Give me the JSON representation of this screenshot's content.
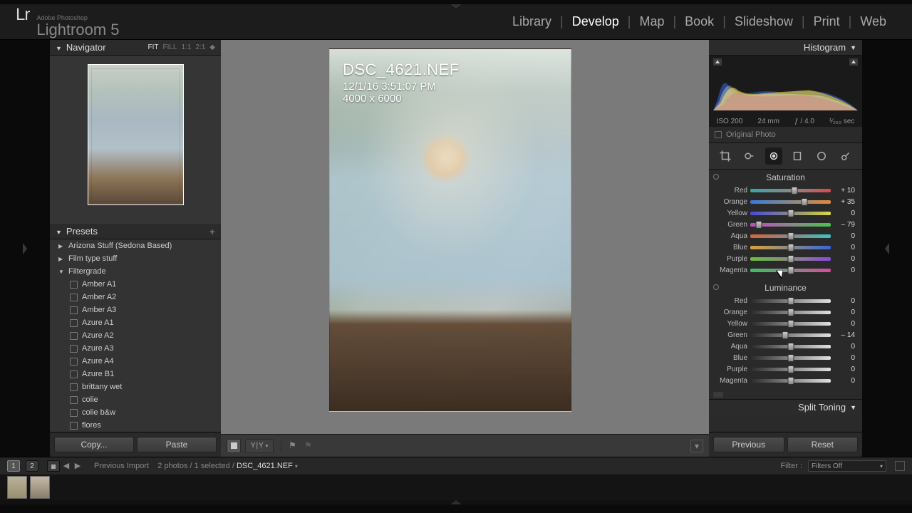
{
  "brand": {
    "lr": "Lr",
    "sub": "Adobe Photoshop",
    "name": "Lightroom 5"
  },
  "modules": [
    "Library",
    "Develop",
    "Map",
    "Book",
    "Slideshow",
    "Print",
    "Web"
  ],
  "active_module": "Develop",
  "navigator": {
    "title": "Navigator",
    "zoom": [
      "FIT",
      "FILL",
      "1:1",
      "2:1"
    ],
    "zoom_sel": "FIT"
  },
  "presets": {
    "title": "Presets",
    "folders": [
      {
        "name": "Arizona Stuff (Sedona Based)",
        "open": false
      },
      {
        "name": "Film type stuff",
        "open": false
      },
      {
        "name": "Filtergrade",
        "open": true,
        "items": [
          "Amber A1",
          "Amber A2",
          "Amber A3",
          "Azure A1",
          "Azure A2",
          "Azure A3",
          "Azure A4",
          "Azure B1",
          "brittany wet",
          "colie",
          "colie b&w",
          "flores"
        ]
      }
    ]
  },
  "left_buttons": {
    "copy": "Copy...",
    "paste": "Paste"
  },
  "photo_meta": {
    "filename": "DSC_4621.NEF",
    "datetime": "12/1/16 3:51:07 PM",
    "dimensions": "4000 x 6000"
  },
  "histogram": {
    "title": "Histogram",
    "meta": {
      "iso": "ISO 200",
      "focal": "24 mm",
      "aperture": "ƒ / 4.0",
      "shutter": "¹⁄₂₅₀ sec"
    },
    "original_label": "Original Photo"
  },
  "saturation": {
    "title": "Saturation",
    "rows": [
      {
        "label": "Red",
        "value": "+ 10",
        "pos": 55,
        "grad": "grad-sat-red"
      },
      {
        "label": "Orange",
        "value": "+ 35",
        "pos": 67,
        "grad": "grad-sat-orange"
      },
      {
        "label": "Yellow",
        "value": "0",
        "pos": 50,
        "grad": "grad-sat-yellow"
      },
      {
        "label": "Green",
        "value": "– 79",
        "pos": 11,
        "grad": "grad-sat-green"
      },
      {
        "label": "Aqua",
        "value": "0",
        "pos": 50,
        "grad": "grad-sat-aqua"
      },
      {
        "label": "Blue",
        "value": "0",
        "pos": 50,
        "grad": "grad-sat-blue"
      },
      {
        "label": "Purple",
        "value": "0",
        "pos": 50,
        "grad": "grad-sat-purple"
      },
      {
        "label": "Magenta",
        "value": "0",
        "pos": 50,
        "grad": "grad-sat-magenta"
      }
    ]
  },
  "luminance": {
    "title": "Luminance",
    "rows": [
      {
        "label": "Red",
        "value": "0",
        "pos": 50,
        "grad": "grad-lum"
      },
      {
        "label": "Orange",
        "value": "0",
        "pos": 50,
        "grad": "grad-lum"
      },
      {
        "label": "Yellow",
        "value": "0",
        "pos": 50,
        "grad": "grad-lum"
      },
      {
        "label": "Green",
        "value": "– 14",
        "pos": 43,
        "grad": "grad-lum"
      },
      {
        "label": "Aqua",
        "value": "0",
        "pos": 50,
        "grad": "grad-lum"
      },
      {
        "label": "Blue",
        "value": "0",
        "pos": 50,
        "grad": "grad-lum"
      },
      {
        "label": "Purple",
        "value": "0",
        "pos": 50,
        "grad": "grad-lum"
      },
      {
        "label": "Magenta",
        "value": "0",
        "pos": 50,
        "grad": "grad-lum"
      }
    ]
  },
  "split_toning": {
    "title": "Split Toning"
  },
  "right_buttons": {
    "previous": "Previous",
    "reset": "Reset"
  },
  "filmstrip": {
    "primary": "1",
    "secondary": "2",
    "source": "Previous Import",
    "count_text": "2 photos / 1 selected /",
    "filename": "DSC_4621.NEF",
    "filter_label": "Filter :",
    "filter_value": "Filters Off"
  }
}
